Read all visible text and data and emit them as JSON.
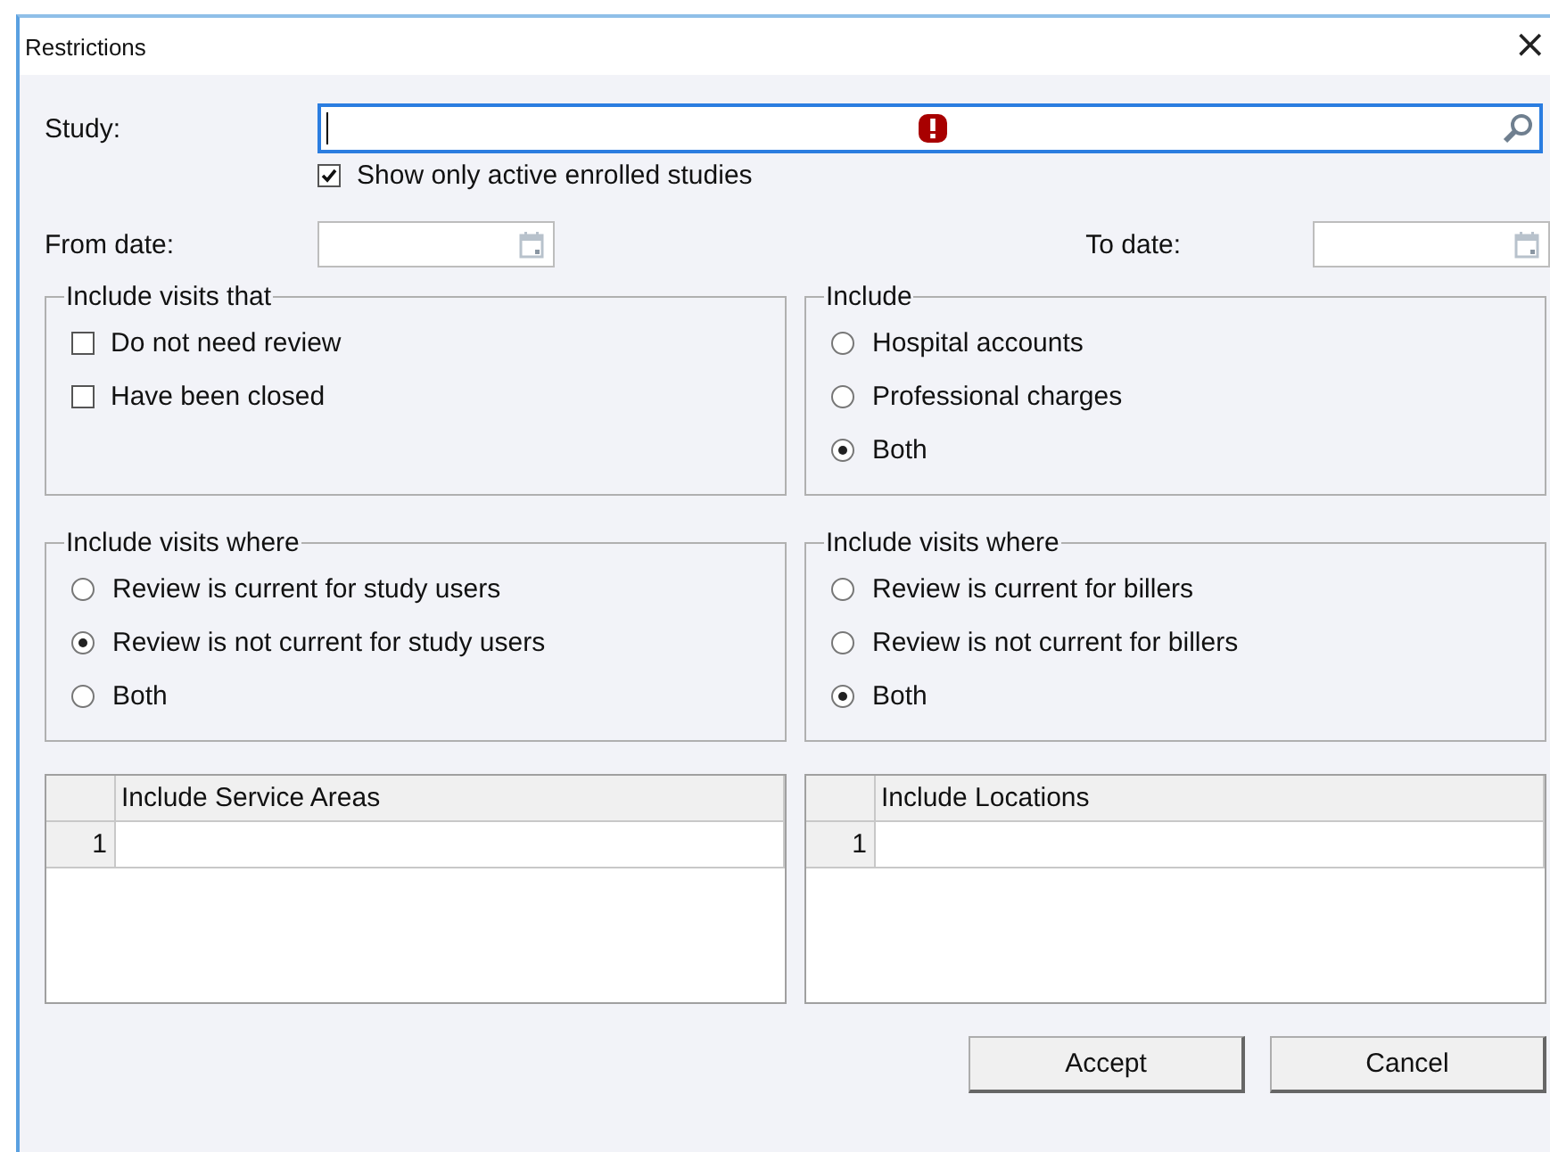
{
  "window": {
    "title": "Restrictions",
    "close": "×"
  },
  "study": {
    "label": "Study:",
    "error": true
  },
  "active_only": {
    "label": "Show only active enrolled studies",
    "checked": true
  },
  "from_date": {
    "label": "From date:"
  },
  "to_date": {
    "label": "To date:"
  },
  "groups": [
    {
      "title": "Include visits that",
      "options": [
        {
          "kind": "checkbox",
          "label": "Do not need review",
          "checked": false
        },
        {
          "kind": "checkbox",
          "label": "Have been closed",
          "checked": false
        }
      ]
    },
    {
      "title": "Include",
      "options": [
        {
          "kind": "radio",
          "label": "Hospital accounts",
          "selected": false
        },
        {
          "kind": "radio",
          "label": "Professional charges",
          "selected": false
        },
        {
          "kind": "radio",
          "label": "Both",
          "selected": true
        }
      ]
    },
    {
      "title": "Include visits where",
      "options": [
        {
          "kind": "radio",
          "label": "Review is current for study users",
          "selected": false
        },
        {
          "kind": "radio",
          "label": "Review is not current for study users",
          "selected": true
        },
        {
          "kind": "radio",
          "label": "Both",
          "selected": false
        }
      ]
    },
    {
      "title": "Include visits where",
      "options": [
        {
          "kind": "radio",
          "label": "Review is current for billers",
          "selected": false
        },
        {
          "kind": "radio",
          "label": "Review is not current for billers",
          "selected": false
        },
        {
          "kind": "radio",
          "label": "Both",
          "selected": true
        }
      ]
    }
  ],
  "grids": [
    {
      "column": "Include Service Areas",
      "rows": [
        "1"
      ]
    },
    {
      "column": "Include Locations",
      "rows": [
        "1"
      ]
    }
  ],
  "buttons": [
    "Accept",
    "Cancel"
  ]
}
